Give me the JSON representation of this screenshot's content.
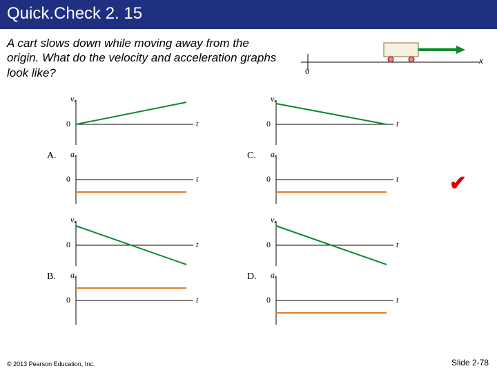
{
  "title": "Quick.Check 2. 15",
  "question": "A cart slows down while moving away from the origin. What do the velocity and acceleration graphs look like?",
  "footer_left": "© 2013 Pearson Education, Inc.",
  "footer_right": "Slide 2-78",
  "cart": {
    "origin_label": "0",
    "x_label": "x"
  },
  "glyphs": {
    "zero": "0",
    "t": "t",
    "vx": "vₓ",
    "ax": "aₓ"
  },
  "options": {
    "A": {
      "label": "A.",
      "v_slope": "up",
      "a_sign": "neg"
    },
    "B": {
      "label": "B.",
      "v_slope": "down_to_neg",
      "a_sign": "pos"
    },
    "C": {
      "label": "C.",
      "v_slope": "down_to_zero",
      "a_sign": "neg",
      "correct": true
    },
    "D": {
      "label": "D.",
      "v_slope": "down_to_neg",
      "a_sign": "neg"
    }
  },
  "chart_data": [
    {
      "option": "A",
      "panel": "velocity",
      "type": "line",
      "x": [
        0,
        1
      ],
      "y": [
        0,
        1
      ],
      "xlabel": "t",
      "ylabel": "vₓ",
      "ylim": [
        -1,
        1
      ]
    },
    {
      "option": "A",
      "panel": "acceleration",
      "type": "line",
      "x": [
        0,
        1
      ],
      "y": [
        -0.5,
        -0.5
      ],
      "xlabel": "t",
      "ylabel": "aₓ",
      "ylim": [
        -1,
        1
      ]
    },
    {
      "option": "B",
      "panel": "velocity",
      "type": "line",
      "x": [
        0,
        1
      ],
      "y": [
        1,
        -1
      ],
      "xlabel": "t",
      "ylabel": "vₓ",
      "ylim": [
        -1,
        1
      ]
    },
    {
      "option": "B",
      "panel": "acceleration",
      "type": "line",
      "x": [
        0,
        1
      ],
      "y": [
        0.5,
        0.5
      ],
      "xlabel": "t",
      "ylabel": "aₓ",
      "ylim": [
        -1,
        1
      ]
    },
    {
      "option": "C",
      "panel": "velocity",
      "type": "line",
      "x": [
        0,
        1
      ],
      "y": [
        1,
        0
      ],
      "xlabel": "t",
      "ylabel": "vₓ",
      "ylim": [
        -1,
        1
      ]
    },
    {
      "option": "C",
      "panel": "acceleration",
      "type": "line",
      "x": [
        0,
        1
      ],
      "y": [
        -0.5,
        -0.5
      ],
      "xlabel": "t",
      "ylabel": "aₓ",
      "ylim": [
        -1,
        1
      ]
    },
    {
      "option": "D",
      "panel": "velocity",
      "type": "line",
      "x": [
        0,
        1
      ],
      "y": [
        1,
        -1
      ],
      "xlabel": "t",
      "ylabel": "vₓ",
      "ylim": [
        -1,
        1
      ]
    },
    {
      "option": "D",
      "panel": "acceleration",
      "type": "line",
      "x": [
        0,
        1
      ],
      "y": [
        -0.5,
        -0.5
      ],
      "xlabel": "t",
      "ylabel": "aₓ",
      "ylim": [
        -1,
        1
      ]
    }
  ]
}
